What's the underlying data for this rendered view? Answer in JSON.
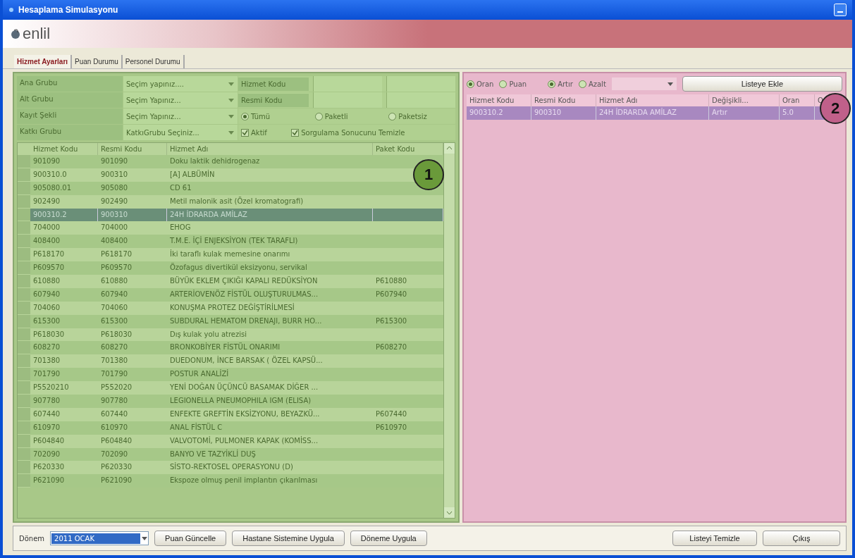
{
  "window": {
    "title": "Hesaplama Simulasyonu"
  },
  "logo": {
    "text": "enlil"
  },
  "tabs": [
    {
      "label": "Hizmet Ayarları",
      "selected": true
    },
    {
      "label": "Puan Durumu",
      "selected": false
    },
    {
      "label": "Personel Durumu",
      "selected": false
    }
  ],
  "filters": {
    "fields": [
      {
        "label": "Ana Grubu",
        "value": "Seçim yapınız...."
      },
      {
        "label": "Alt Grubu",
        "value": "Seçim Yapınız..."
      },
      {
        "label": "Kayıt Şekli",
        "value": "Seçim Yapınız..."
      },
      {
        "label": "Katkı Grubu",
        "value": "KatkıGrubu Seçiniz..."
      }
    ],
    "codes": [
      {
        "label": "Hizmet Kodu"
      },
      {
        "label": "Resmi Kodu"
      }
    ],
    "package_options": [
      {
        "label": "Tümü",
        "selected": true
      },
      {
        "label": "Paketli",
        "selected": false
      },
      {
        "label": "Paketsiz",
        "selected": false
      }
    ],
    "checks": [
      {
        "label": "Aktif",
        "checked": true
      },
      {
        "label": "Sorgulama Sonucunu Temizle",
        "checked": true
      }
    ]
  },
  "services_table": {
    "columns": [
      "Hizmet Kodu",
      "Resmi Kodu",
      "Hizmet Adı",
      "Paket Kodu"
    ],
    "marker": "1",
    "rows": [
      {
        "cells": [
          "901090",
          "901090",
          "Doku laktik dehidrogenaz",
          ""
        ],
        "selected": false
      },
      {
        "cells": [
          "900310.0",
          "900310",
          "[A] ALBÜMİN",
          ""
        ],
        "selected": false
      },
      {
        "cells": [
          "905080.01",
          "905080",
          "CD 61",
          ""
        ],
        "selected": false
      },
      {
        "cells": [
          "902490",
          "902490",
          "Metil malonik asit (Özel kromatografi)",
          ""
        ],
        "selected": false
      },
      {
        "cells": [
          "900310.2",
          "900310",
          "24H İDRARDA AMİLAZ",
          ""
        ],
        "selected": true
      },
      {
        "cells": [
          "704000",
          "704000",
          "EHOG",
          ""
        ],
        "selected": false
      },
      {
        "cells": [
          "408400",
          "408400",
          "T.M.E. İÇİ ENJEKSİYON (TEK TARAFLI)",
          ""
        ],
        "selected": false
      },
      {
        "cells": [
          "P618170",
          "P618170",
          "İki taraflı kulak memesine onarımı",
          ""
        ],
        "selected": false
      },
      {
        "cells": [
          "P609570",
          "P609570",
          "Özofagus divertikül eksizyonu, servikal",
          ""
        ],
        "selected": false
      },
      {
        "cells": [
          "610880",
          "610880",
          "BÜYÜK EKLEM ÇIKIĞI KAPALI REDÜKSİYON",
          "P610880"
        ],
        "selected": false
      },
      {
        "cells": [
          "607940",
          "607940",
          "ARTERİOVENÖZ FİSTÜL OLUŞTURULMAS...",
          "P607940"
        ],
        "selected": false
      },
      {
        "cells": [
          "704060",
          "704060",
          "KONUŞMA PROTEZ DEĞİŞTİRİLMESİ",
          ""
        ],
        "selected": false
      },
      {
        "cells": [
          "615300",
          "615300",
          "SUBDURAL HEMATOM DRENAJI, BURR HO...",
          "P615300"
        ],
        "selected": false
      },
      {
        "cells": [
          "P618030",
          "P618030",
          "Dış kulak yolu atrezisi",
          ""
        ],
        "selected": false
      },
      {
        "cells": [
          "608270",
          "608270",
          "BRONKOBİYER FİSTÜL ONARIMI",
          "P608270"
        ],
        "selected": false
      },
      {
        "cells": [
          "701380",
          "701380",
          "DUEDONUM, İNCE BARSAK ( ÖZEL KAPSÜ...",
          ""
        ],
        "selected": false
      },
      {
        "cells": [
          "701790",
          "701790",
          "POSTUR ANALİZİ",
          ""
        ],
        "selected": false
      },
      {
        "cells": [
          "P5520210",
          "P552020",
          "YENİ DOĞAN ÜÇÜNCÜ BASAMAK DİĞER ...",
          ""
        ],
        "selected": false
      },
      {
        "cells": [
          "907780",
          "907780",
          "LEGIONELLA PNEUMOPHILA IGM (ELISA)",
          ""
        ],
        "selected": false
      },
      {
        "cells": [
          "607440",
          "607440",
          "ENFEKTE GREFTİN EKSİZYONU, BEYAZKÜ...",
          "P607440"
        ],
        "selected": false
      },
      {
        "cells": [
          "610970",
          "610970",
          "ANAL FİSTÜL C",
          "P610970"
        ],
        "selected": false
      },
      {
        "cells": [
          "P604840",
          "P604840",
          "VALVOTOMİ, PULMONER KAPAK (KOMİSS...",
          ""
        ],
        "selected": false
      },
      {
        "cells": [
          "702090",
          "702090",
          "BANYO VE TAZYİKLİ DUŞ",
          ""
        ],
        "selected": false
      },
      {
        "cells": [
          "P620330",
          "P620330",
          "SİSTO-REKTOSEL OPERASYONU    (D)",
          ""
        ],
        "selected": false
      },
      {
        "cells": [
          "P621090",
          "P621090",
          "Ekspoze olmuş penil implantın çıkarılması",
          ""
        ],
        "selected": false
      }
    ]
  },
  "change_panel": {
    "modes": [
      {
        "label": "Oran",
        "selected": true
      },
      {
        "label": "Puan",
        "selected": false
      }
    ],
    "directions": [
      {
        "label": "Artır",
        "selected": true
      },
      {
        "label": "Azalt",
        "selected": false
      }
    ],
    "add_button": "Listeye Ekle",
    "marker": "2",
    "columns": [
      "Hizmet Kodu",
      "Resmi Kodu",
      "Hizmet Adı",
      "Değişikli...",
      "Oran",
      "O"
    ],
    "rows": [
      {
        "cells": [
          "900310.2",
          "900310",
          "24H İDRARDA AMİLAZ",
          "Artır",
          "5.0",
          ""
        ],
        "selected": true
      }
    ]
  },
  "footer": {
    "period_label": "Dönem",
    "period_value": "2011 OCAK",
    "buttons": [
      "Puan Güncelle",
      "Hastane Sistemine Uygula",
      "Döneme Uygula"
    ],
    "right_buttons": [
      "Listeyi Temizle",
      "Çıkış"
    ]
  }
}
